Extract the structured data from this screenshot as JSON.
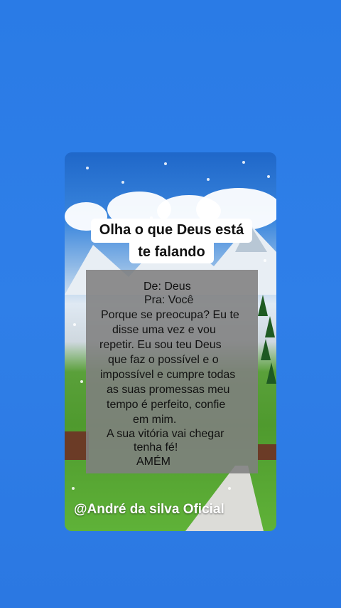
{
  "title": {
    "line1": "Olha o que Deus está",
    "line2": "te falando"
  },
  "message": {
    "lines": [
      "De: Deus",
      "Pra: Você",
      "Porque se preocupa? Eu te",
      "disse uma vez e vou",
      "repetir. Eu sou teu Deus",
      "que faz o possível e o",
      "impossível e cumpre todas",
      "as suas promessas meu",
      "tempo é perfeito, confie",
      "em mim.",
      "A sua vitória vai chegar",
      "tenha fé!",
      "AMÉM"
    ]
  },
  "signature": "@André da silva Oficial",
  "colors": {
    "background": "#2f7fe8",
    "message_box": "#808080",
    "title_box": "#ffffff"
  }
}
